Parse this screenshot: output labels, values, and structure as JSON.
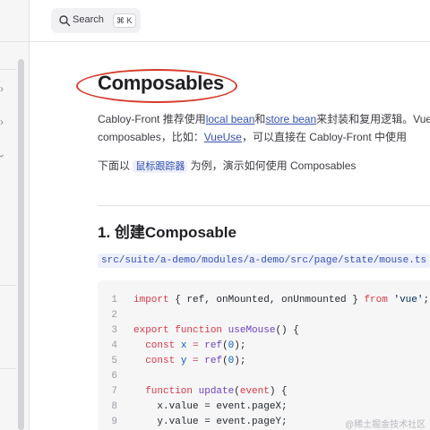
{
  "search": {
    "label": "Search",
    "shortcut": "⌘ K"
  },
  "page": {
    "title": "Composables",
    "intro_line1": {
      "pre": "Cabloy-Front 推荐使用",
      "link1": "local bean",
      "mid": "和",
      "link2": "store bean",
      "post": "来封装和复用逻辑。Vue"
    },
    "intro_line2": {
      "pre": "composables，比如：",
      "link": "VueUse",
      "post": "，可以直接在 Cabloy-Front 中使用"
    },
    "example_line": {
      "pre": "下面以 ",
      "tag": "鼠标跟踪器",
      "post": " 为例，演示如何使用 Composables"
    },
    "section_heading": "1. 创建Composable",
    "file_path": "src/suite/a-demo/modules/a-demo/src/page/state/mouse.ts"
  },
  "code": {
    "line_numbers": [
      "1",
      "2",
      "3",
      "4",
      "5",
      "6",
      "7",
      "8",
      "9"
    ],
    "lines": [
      [
        {
          "t": "import",
          "c": "kw"
        },
        {
          "t": " { ref, onMounted, onUnmounted } ",
          "c": ""
        },
        {
          "t": "from",
          "c": "kw"
        },
        {
          "t": " ",
          "c": ""
        },
        {
          "t": "'vue'",
          "c": "str"
        },
        {
          "t": ";",
          "c": ""
        }
      ],
      [],
      [
        {
          "t": "export",
          "c": "kw"
        },
        {
          "t": " ",
          "c": ""
        },
        {
          "t": "function",
          "c": "kw"
        },
        {
          "t": " ",
          "c": ""
        },
        {
          "t": "useMouse",
          "c": "fn"
        },
        {
          "t": "() {",
          "c": ""
        }
      ],
      [
        {
          "t": "  ",
          "c": ""
        },
        {
          "t": "const",
          "c": "kw"
        },
        {
          "t": " ",
          "c": ""
        },
        {
          "t": "x",
          "c": "num"
        },
        {
          "t": " = ",
          "c": "kw"
        },
        {
          "t": "ref",
          "c": "fn"
        },
        {
          "t": "(",
          "c": ""
        },
        {
          "t": "0",
          "c": "num"
        },
        {
          "t": ");",
          "c": ""
        }
      ],
      [
        {
          "t": "  ",
          "c": ""
        },
        {
          "t": "const",
          "c": "kw"
        },
        {
          "t": " ",
          "c": ""
        },
        {
          "t": "y",
          "c": "num"
        },
        {
          "t": " = ",
          "c": "kw"
        },
        {
          "t": "ref",
          "c": "fn"
        },
        {
          "t": "(",
          "c": ""
        },
        {
          "t": "0",
          "c": "num"
        },
        {
          "t": ");",
          "c": ""
        }
      ],
      [],
      [
        {
          "t": "  ",
          "c": ""
        },
        {
          "t": "function",
          "c": "kw"
        },
        {
          "t": " ",
          "c": ""
        },
        {
          "t": "update",
          "c": "fn"
        },
        {
          "t": "(",
          "c": ""
        },
        {
          "t": "event",
          "c": "kw"
        },
        {
          "t": ") {",
          "c": ""
        }
      ],
      [
        {
          "t": "    x.value = event.pageX;",
          "c": ""
        }
      ],
      [
        {
          "t": "    y.value = event.pageY;",
          "c": ""
        }
      ]
    ]
  },
  "watermark": "@稀土掘金技术社区",
  "colors": {
    "accent": "#3451b2",
    "highlight_circle": "#d63b2b"
  }
}
